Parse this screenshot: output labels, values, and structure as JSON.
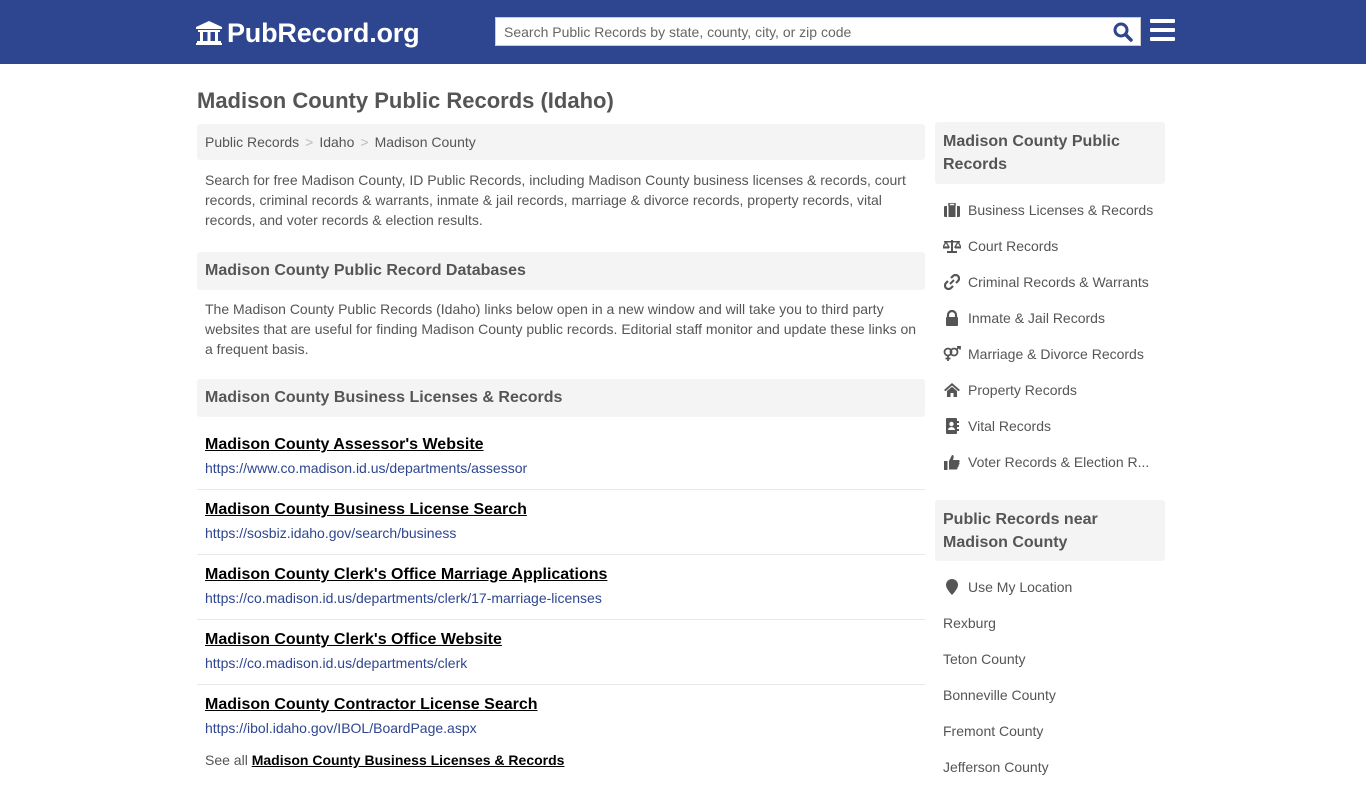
{
  "header": {
    "logo_text": "PubRecord.org",
    "search_placeholder": "Search Public Records by state, county, city, or zip code",
    "search_value": "",
    "colors": {
      "topbar": "#2e4690",
      "link_url": "#2e4690"
    }
  },
  "page": {
    "title": "Madison County Public Records (Idaho)",
    "breadcrumb": [
      "Public Records",
      "Idaho",
      "Madison County"
    ],
    "breadcrumb_separator": ">",
    "intro": "Search for free Madison County, ID Public Records, including Madison County business licenses & records, court records, criminal records & warrants, inmate & jail records, marriage & divorce records, property records, vital records, and voter records & election results."
  },
  "databases": {
    "heading": "Madison County Public Record Databases",
    "description": "The Madison County Public Records (Idaho) links below open in a new window and will take you to third party websites that are useful for finding Madison County public records. Editorial staff monitor and update these links on a frequent basis."
  },
  "business": {
    "heading": "Madison County Business Licenses & Records",
    "links": [
      {
        "title": "Madison County Assessor's Website",
        "url": "https://www.co.madison.id.us/departments/assessor"
      },
      {
        "title": "Madison County Business License Search",
        "url": "https://sosbiz.idaho.gov/search/business"
      },
      {
        "title": "Madison County Clerk's Office Marriage Applications",
        "url": "https://co.madison.id.us/departments/clerk/17-marriage-licenses"
      },
      {
        "title": "Madison County Clerk's Office Website",
        "url": "https://co.madison.id.us/departments/clerk"
      },
      {
        "title": "Madison County Contractor License Search",
        "url": "https://ibol.idaho.gov/IBOL/BoardPage.aspx"
      }
    ],
    "see_all_prefix": "See all",
    "see_all_link": "Madison County Business Licenses & Records"
  },
  "sidebar": {
    "records_heading": "Madison County Public Records",
    "records": [
      {
        "icon": "briefcase-icon",
        "label": "Business Licenses & Records"
      },
      {
        "icon": "balance-scale-icon",
        "label": "Court Records"
      },
      {
        "icon": "link-icon",
        "label": "Criminal Records & Warrants"
      },
      {
        "icon": "lock-icon",
        "label": "Inmate & Jail Records"
      },
      {
        "icon": "venus-mars-icon",
        "label": "Marriage & Divorce Records"
      },
      {
        "icon": "home-icon",
        "label": "Property Records"
      },
      {
        "icon": "address-book-icon",
        "label": "Vital Records"
      },
      {
        "icon": "thumbs-up-icon",
        "label": "Voter Records & Election R..."
      }
    ],
    "near_heading": "Public Records near Madison County",
    "use_location": "Use My Location",
    "near": [
      "Rexburg",
      "Teton County",
      "Bonneville County",
      "Fremont County",
      "Jefferson County"
    ]
  }
}
